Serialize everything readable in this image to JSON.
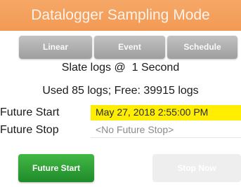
{
  "header": {
    "title": "Datalogger Sampling Mode"
  },
  "modes": [
    {
      "label": "Linear"
    },
    {
      "label": "Event"
    },
    {
      "label": "Schedule"
    }
  ],
  "status": {
    "rate": "Slate logs @  1 Second",
    "usage": "Used 85 logs; Free: 39915 logs"
  },
  "future_start": {
    "label": "Future Start",
    "value": "May 27, 2018 2:55:00 PM"
  },
  "future_stop": {
    "label": "Future Stop",
    "value": "<No Future Stop>"
  },
  "actions": {
    "future_start_label": "Future Start",
    "stop_now_label": "Stop Now"
  },
  "colors": {
    "header": "#f29a55",
    "mode_button": "#b0b0b0",
    "start_highlight": "#ffee00",
    "start_button": "#2fa33a",
    "stop_button_disabled": "#eeeeee"
  }
}
